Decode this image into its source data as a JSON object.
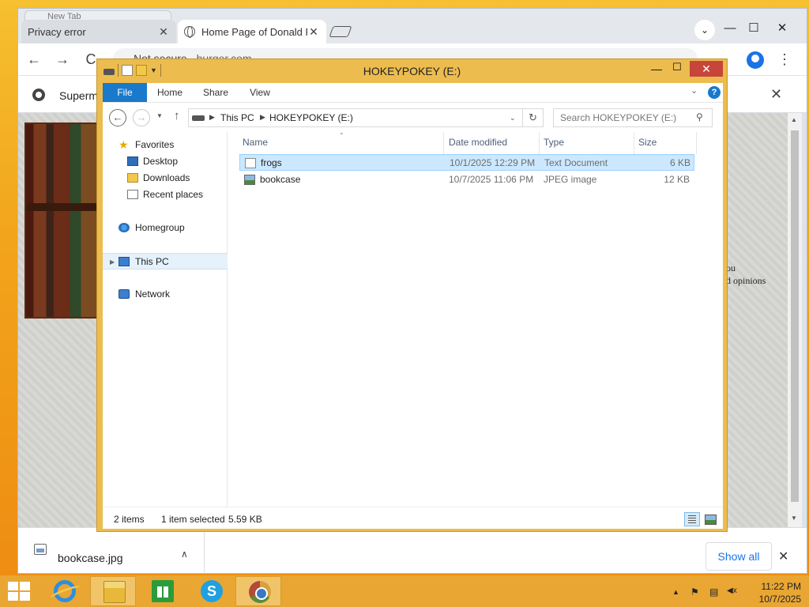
{
  "browser": {
    "ghost_tab_label": "New Tab",
    "tabs": [
      {
        "label": "Privacy error",
        "close": "✕"
      },
      {
        "label": "Home Page of Donald F",
        "close": "✕"
      }
    ],
    "window_controls": {
      "minimize": "—",
      "maximize": "☐",
      "close": "✕"
    },
    "nav": {
      "back": "←",
      "forward": "→",
      "reload": "C"
    },
    "omnibox": {
      "security": "Not secure",
      "url": "burger.com"
    },
    "menu": "⋮",
    "infobar": {
      "text": "Supermi",
      "close": "✕"
    },
    "page_text": [
      "ou",
      "d opinions"
    ],
    "downloads": {
      "file": "bookcase.jpg",
      "chevron": "∧",
      "show_all": "Show all",
      "close": "✕"
    }
  },
  "explorer": {
    "title": "HOKEYPOKEY (E:)",
    "controls": {
      "minimize": "—",
      "maximize": "☐",
      "close": "✕"
    },
    "ribbon_tabs": [
      "File",
      "Home",
      "Share",
      "View"
    ],
    "help": "?",
    "address": {
      "breadcrumbs": [
        "This PC",
        "HOKEYPOKEY (E:)"
      ],
      "search_placeholder": "Search HOKEYPOKEY (E:)"
    },
    "nav_pane": {
      "favorites": "Favorites",
      "favorites_items": [
        "Desktop",
        "Downloads",
        "Recent places"
      ],
      "homegroup": "Homegroup",
      "this_pc": "This PC",
      "network": "Network"
    },
    "columns": [
      "Name",
      "Date modified",
      "Type",
      "Size"
    ],
    "files": [
      {
        "name": "frogs",
        "date": "10/1/2025 12:29 PM",
        "type": "Text Document",
        "size": "6 KB",
        "icon": "text-document-icon",
        "selected": true
      },
      {
        "name": "bookcase",
        "date": "10/7/2025 11:06 PM",
        "type": "JPEG image",
        "size": "12 KB",
        "icon": "jpeg-image-icon",
        "selected": false
      }
    ],
    "status": {
      "items": "2 items",
      "selected": "1 item selected",
      "size": "5.59 KB"
    }
  },
  "taskbar": {
    "apps": [
      "internet-explorer",
      "file-explorer",
      "store",
      "skype",
      "chrome"
    ],
    "tray": {
      "arrow": "▲",
      "flag": "⚑",
      "network": "▤",
      "volume": "◀x"
    },
    "time": "11:22 PM",
    "date": "10/7/2025"
  },
  "colors": {
    "accent": "#1979ca",
    "titlebar": "#ecbc4f",
    "taskbar": "#e9a633",
    "selection": "#cce8ff"
  }
}
